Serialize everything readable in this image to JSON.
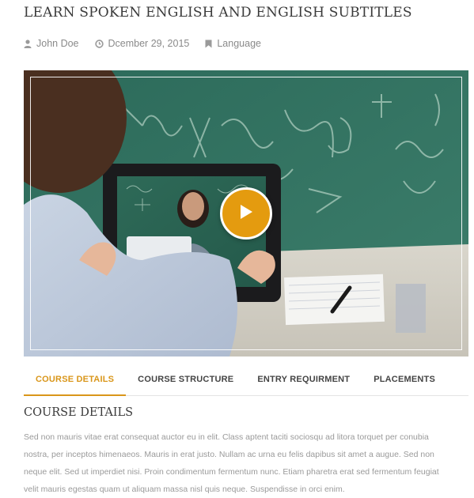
{
  "post": {
    "title": "LEARN SPOKEN ENGLISH AND ENGLISH SUBTITLES",
    "author": "John Doe",
    "date": "Dcember 29, 2015",
    "category": "Language"
  },
  "icons": {
    "author": "user-icon",
    "date": "clock-icon",
    "category": "bookmark-icon",
    "play": "play-icon"
  },
  "colors": {
    "accent": "#e49b0f",
    "active_tab": "#d9961a",
    "muted_text": "#9a9a9a"
  },
  "tabs": [
    {
      "label": "COURSE DETAILS",
      "active": true
    },
    {
      "label": "COURSE STRUCTURE",
      "active": false
    },
    {
      "label": "ENTRY REQUIRMENT",
      "active": false
    },
    {
      "label": "PLACEMENTS",
      "active": false
    }
  ],
  "content": {
    "heading": "COURSE DETAILS",
    "paragraph": "Sed non mauris vitae erat consequat auctor eu in elit. Class aptent taciti sociosqu ad litora torquet per conubia nostra, per inceptos himenaeos. Mauris in erat justo. Nullam ac urna eu felis dapibus sit amet a augue. Sed non neque elit. Sed ut imperdiet nisi. Proin condimentum fermentum nunc. Etiam pharetra erat sed fermentum feugiat velit mauris egestas quam ut aliquam massa nisl quis neque. Suspendisse in orci enim."
  }
}
